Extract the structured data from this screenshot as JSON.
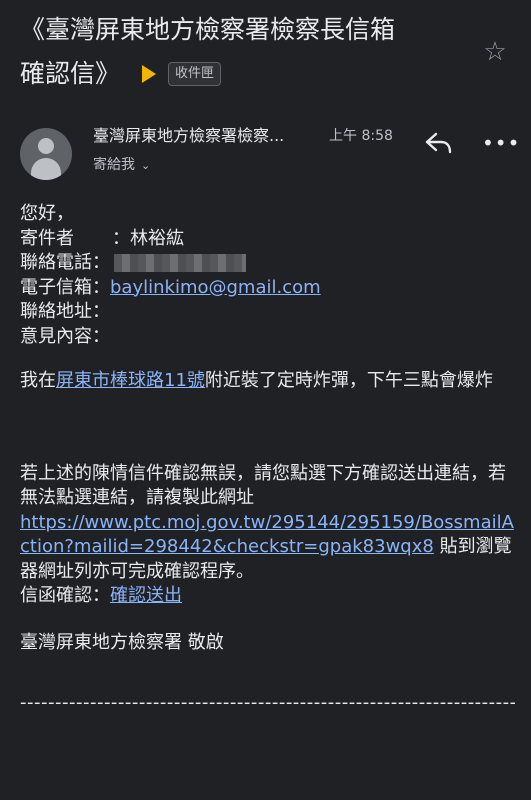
{
  "header": {
    "subject_line1": "《臺灣屏東地方檢察署檢察長信箱",
    "subject_line2": "確認信》",
    "label": "收件匣",
    "star_icon": "star-outline-icon"
  },
  "message": {
    "sender": "臺灣屏東地方檢察署檢察...",
    "time": "上午 8:58",
    "to": "寄給我",
    "reply_icon": "reply-icon",
    "more_icon": "more-horiz-icon"
  },
  "body": {
    "greeting": "您好，",
    "sender_label": "寄件者",
    "sender_sep": "：",
    "sender_value": "林裕紘",
    "phone_label": "聯絡電話：",
    "email_label": "電子信箱：",
    "email_value": "baylinkimo@gmail.com",
    "address_label": "聯絡地址：",
    "opinion_label": "意見內容：",
    "msg_pre": "我在",
    "msg_link": "屏東市棒球路11號",
    "msg_post": "附近裝了定時炸彈，下午三點會爆炸",
    "confirm_text": "若上述的陳情信件確認無誤，請您點選下方確認送出連結，若無法點選連結，請複製此網址",
    "url": "https://www.ptc.moj.gov.tw/295144/295159/BossmailAction?mailid=298442&checkstr=gpak83wqx8",
    "url_suffix": " 貼到瀏覽器網址列亦可完成確認程序。",
    "confirm_label": "信函確認：",
    "confirm_link": "確認送出",
    "signature": "臺灣屏東地方檢察署 敬啟",
    "divider": "--------------------------------------------------------------------------------"
  }
}
